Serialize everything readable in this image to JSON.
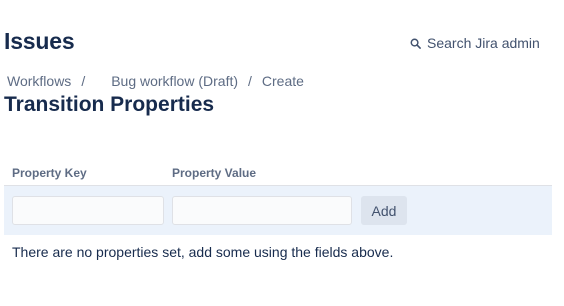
{
  "header": {
    "title": "Issues",
    "admin_search": {
      "label": "Search Jira admin",
      "icon": "search-icon"
    }
  },
  "breadcrumb": {
    "items": [
      "Workflows",
      "Bug workflow (Draft)",
      "Create"
    ],
    "separator": "/"
  },
  "section": {
    "title": "Transition Properties"
  },
  "properties_table": {
    "columns": [
      "Property Key",
      "Property Value"
    ],
    "key_input": {
      "value": "",
      "placeholder": ""
    },
    "value_input": {
      "value": "",
      "placeholder": ""
    },
    "add_label": "Add",
    "empty_message": "There are no properties set, add some using the fields above.",
    "row_background": "#ebf2fb"
  }
}
